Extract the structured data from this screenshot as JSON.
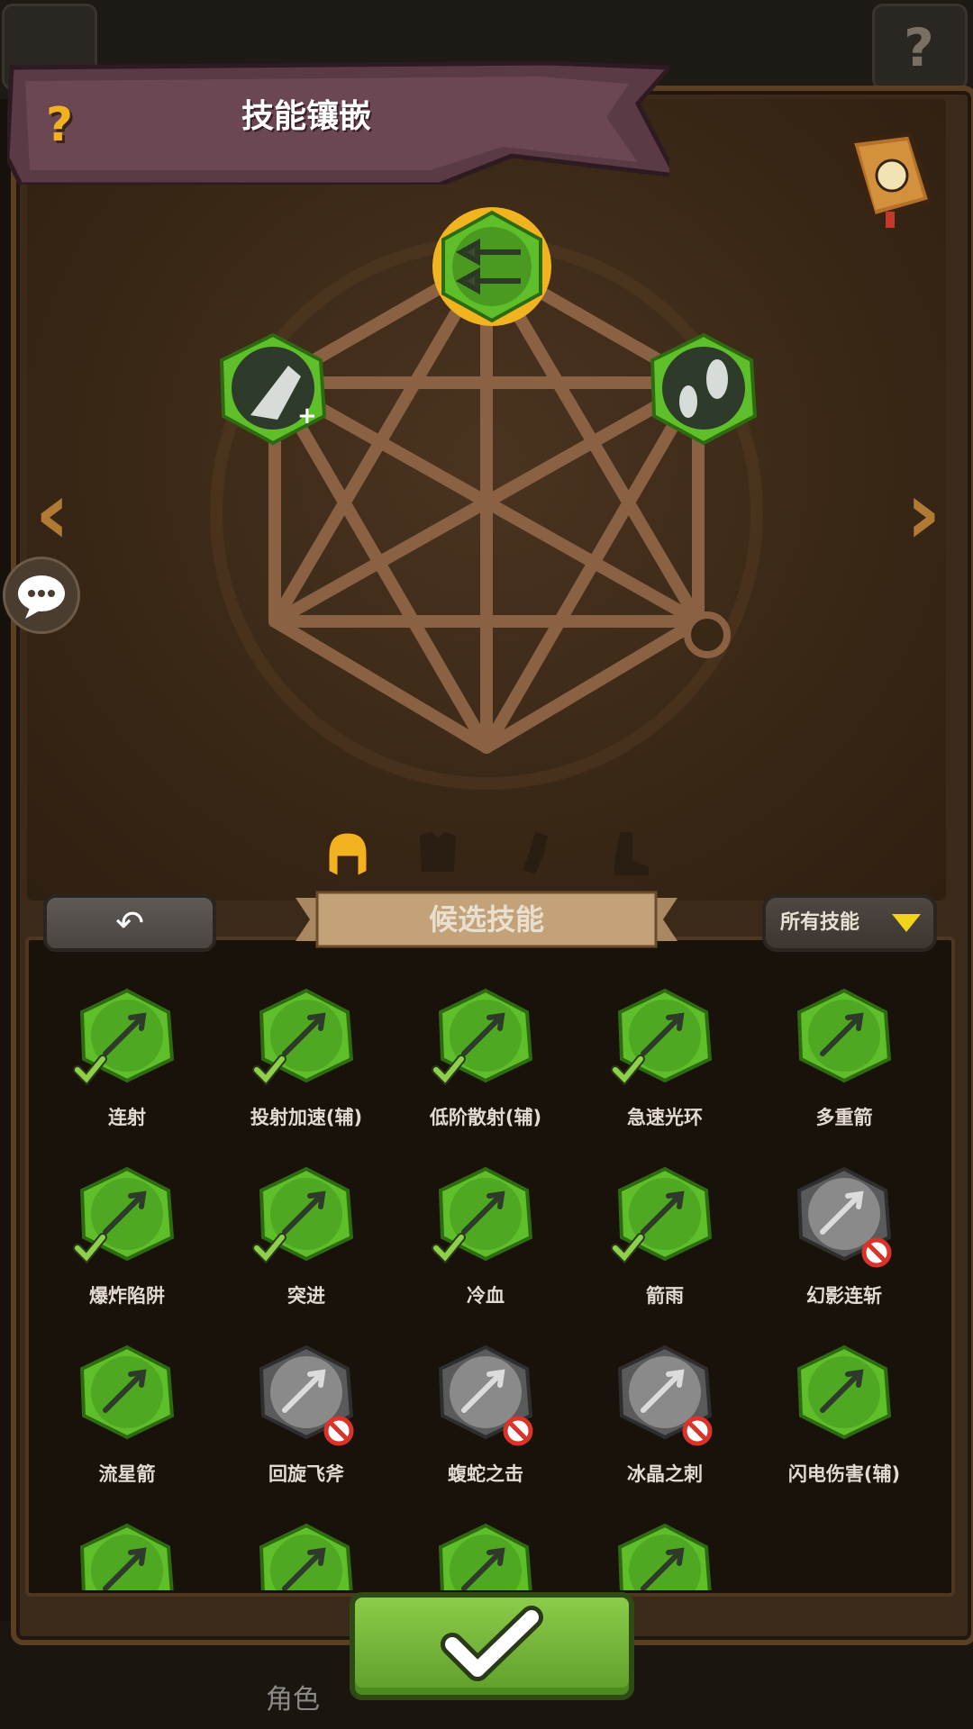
{
  "header": {
    "title": "技能镶嵌",
    "help_glyph": "?"
  },
  "colors": {
    "accent_green": "#5fbf2a",
    "banner": "#5a3a45",
    "gold": "#f2b21f",
    "panel_wood": "#3b2a19"
  },
  "top_bar": {
    "right_help_glyph": "?"
  },
  "icons": {
    "book": "spellbook-icon",
    "chat": "chat-bubble-icon",
    "left_arrow": "chevron-left-icon",
    "right_arrow": "chevron-right-icon"
  },
  "pentagram": {
    "slots": [
      {
        "name": "top",
        "skill": "multi-arrow-skill-icon",
        "state": "selected"
      },
      {
        "name": "left",
        "skill": "projectile-speed-skill-icon",
        "state": "equipped"
      },
      {
        "name": "right",
        "skill": "scatter-shot-skill-icon",
        "state": "equipped"
      },
      {
        "name": "bottom-right",
        "skill": "empty-slot",
        "state": "empty"
      }
    ]
  },
  "categories": [
    {
      "name": "helmet-tab",
      "active": true
    },
    {
      "name": "armor-tab",
      "active": false
    },
    {
      "name": "glove-tab",
      "active": false
    },
    {
      "name": "boots-tab",
      "active": false
    }
  ],
  "toolbar": {
    "back_glyph": "↶",
    "candidate_label": "候选技能",
    "filter_label": "所有技能"
  },
  "skills": [
    {
      "label": "连射",
      "state": "equipped",
      "icon": "rapid-fire-icon"
    },
    {
      "label": "投射加速(辅)",
      "state": "equipped",
      "icon": "projectile-speed-icon"
    },
    {
      "label": "低阶散射(辅)",
      "state": "equipped",
      "icon": "scatter-shot-icon"
    },
    {
      "label": "急速光环",
      "state": "equipped",
      "icon": "haste-aura-icon"
    },
    {
      "label": "多重箭",
      "state": "available",
      "icon": "multi-arrow-icon"
    },
    {
      "label": "爆炸陷阱",
      "state": "equipped",
      "icon": "explosive-trap-icon"
    },
    {
      "label": "突进",
      "state": "equipped",
      "icon": "dash-icon"
    },
    {
      "label": "冷血",
      "state": "equipped",
      "icon": "cold-blood-icon"
    },
    {
      "label": "箭雨",
      "state": "equipped",
      "icon": "arrow-rain-icon"
    },
    {
      "label": "幻影连斩",
      "state": "locked",
      "icon": "phantom-slash-icon"
    },
    {
      "label": "流星箭",
      "state": "available",
      "icon": "meteor-arrow-icon"
    },
    {
      "label": "回旋飞斧",
      "state": "locked",
      "icon": "boomerang-axe-icon"
    },
    {
      "label": "蝮蛇之击",
      "state": "locked",
      "icon": "viper-strike-icon"
    },
    {
      "label": "冰晶之刺",
      "state": "locked",
      "icon": "ice-spike-icon"
    },
    {
      "label": "闪电伤害(辅)",
      "state": "available",
      "icon": "lightning-icon"
    },
    {
      "label": "",
      "state": "available",
      "icon": "burst-icon"
    },
    {
      "label": "",
      "state": "available",
      "icon": "spiked-shield-icon"
    },
    {
      "label": "",
      "state": "available",
      "icon": "winged-boot-icon"
    },
    {
      "label": "",
      "state": "available",
      "icon": "poison-flask-icon"
    }
  ],
  "footer": {
    "tab_label": "角色"
  }
}
